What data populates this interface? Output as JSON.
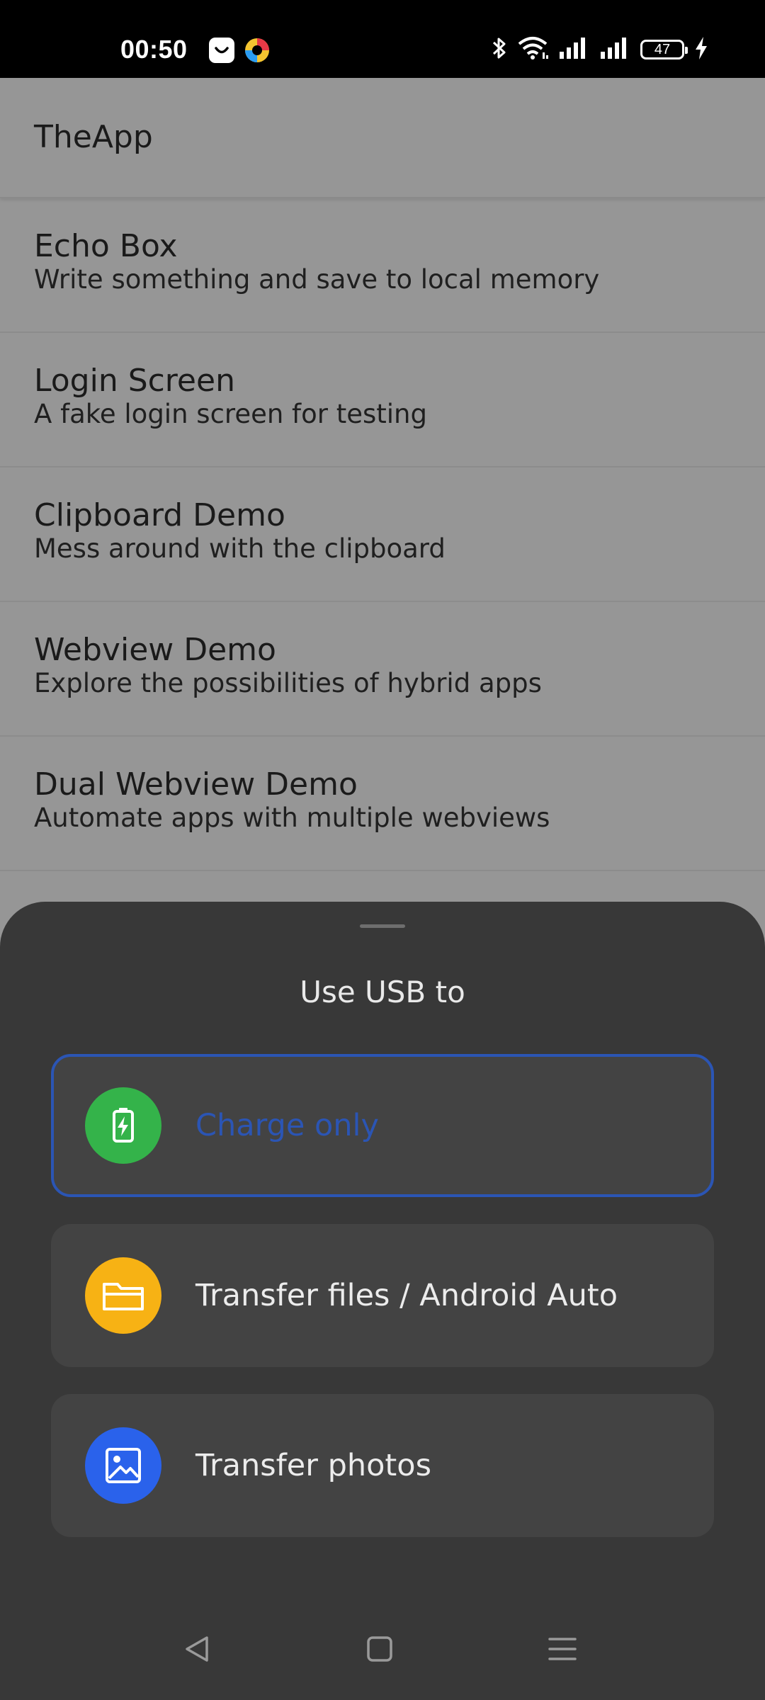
{
  "status_bar": {
    "time": "00:50",
    "battery_level": "47",
    "icons": [
      "notification-app-icon",
      "notification-app-icon-2",
      "bluetooth-icon",
      "wifi-icon",
      "signal-icon",
      "signal-icon-2",
      "battery-icon",
      "charging-icon"
    ]
  },
  "app": {
    "title": "TheApp",
    "items": [
      {
        "title": "Echo Box",
        "subtitle": "Write something and save to local memory"
      },
      {
        "title": "Login Screen",
        "subtitle": "A fake login screen for testing"
      },
      {
        "title": "Clipboard Demo",
        "subtitle": "Mess around with the clipboard"
      },
      {
        "title": "Webview Demo",
        "subtitle": "Explore the possibilities of hybrid apps"
      },
      {
        "title": "Dual Webview Demo",
        "subtitle": "Automate apps with multiple webviews"
      }
    ]
  },
  "usb_sheet": {
    "title": "Use USB to",
    "options": [
      {
        "label": "Charge only",
        "icon": "battery-charging-icon",
        "color": "#34b34a",
        "selected": true
      },
      {
        "label": "Transfer files / Android Auto",
        "icon": "folder-icon",
        "color": "#f7b214",
        "selected": false
      },
      {
        "label": "Transfer photos",
        "icon": "image-icon",
        "color": "#2a62eb",
        "selected": false
      }
    ],
    "selected_color": "#2b55b4"
  },
  "nav_bar": {
    "buttons": [
      "back-icon",
      "home-icon",
      "recents-menu-icon"
    ]
  }
}
